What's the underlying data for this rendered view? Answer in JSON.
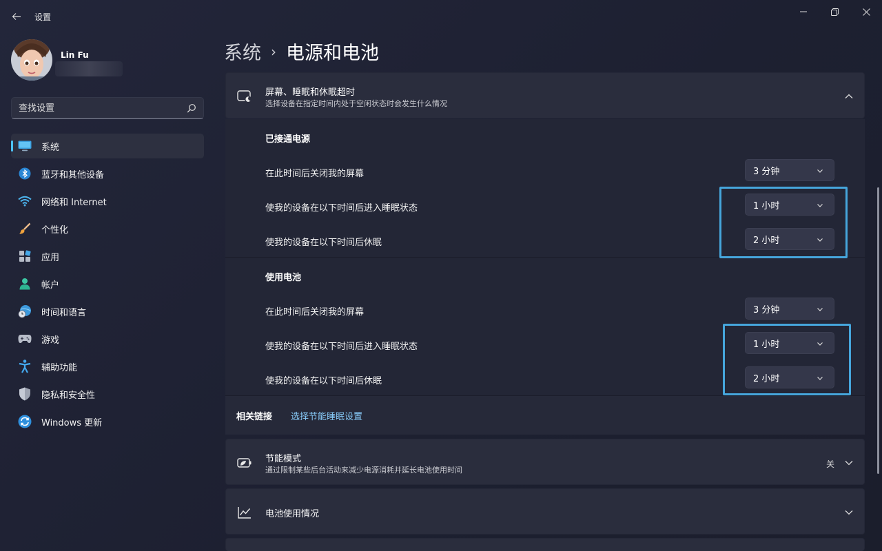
{
  "window": {
    "app_title": "设置",
    "controls": {
      "minimize": "minimize",
      "maximize": "maximize",
      "close": "close"
    }
  },
  "user": {
    "name": "Lin Fu"
  },
  "search": {
    "placeholder": "查找设置"
  },
  "sidebar": {
    "items": [
      {
        "label": "系统",
        "icon": "monitor-icon",
        "active": true
      },
      {
        "label": "蓝牙和其他设备",
        "icon": "bluetooth-icon"
      },
      {
        "label": "网络和 Internet",
        "icon": "wifi-icon"
      },
      {
        "label": "个性化",
        "icon": "brush-icon"
      },
      {
        "label": "应用",
        "icon": "apps-icon"
      },
      {
        "label": "帐户",
        "icon": "person-icon"
      },
      {
        "label": "时间和语言",
        "icon": "globe-clock-icon"
      },
      {
        "label": "游戏",
        "icon": "gamepad-icon"
      },
      {
        "label": "辅助功能",
        "icon": "accessibility-icon"
      },
      {
        "label": "隐私和安全性",
        "icon": "shield-icon"
      },
      {
        "label": "Windows 更新",
        "icon": "update-icon"
      }
    ]
  },
  "breadcrumb": {
    "parent": "系统",
    "separator": "›",
    "current": "电源和电池"
  },
  "screen_sleep": {
    "title": "屏幕、睡眠和休眠超时",
    "subtitle": "选择设备在指定时间内处于空闲状态时会发生什么情况",
    "plugged_in": {
      "heading": "已接通电源",
      "rows": [
        {
          "label": "在此时间后关闭我的屏幕",
          "value": "3 分钟"
        },
        {
          "label": "使我的设备在以下时间后进入睡眠状态",
          "value": "1 小时"
        },
        {
          "label": "使我的设备在以下时间后休眠",
          "value": "2 小时"
        }
      ]
    },
    "battery": {
      "heading": "使用电池",
      "rows": [
        {
          "label": "在此时间后关闭我的屏幕",
          "value": "3 分钟"
        },
        {
          "label": "使我的设备在以下时间后进入睡眠状态",
          "value": "1 小时"
        },
        {
          "label": "使我的设备在以下时间后休眠",
          "value": "2 小时"
        }
      ]
    }
  },
  "related": {
    "label": "相关链接",
    "link": "选择节能睡眠设置"
  },
  "energy_saver": {
    "title": "节能模式",
    "subtitle": "通过限制某些后台活动来减少电源消耗并延长电池使用时间",
    "status": "关"
  },
  "battery_usage": {
    "title": "电池使用情况"
  },
  "colors": {
    "accent": "#4cc2ff",
    "highlight": "#46a6dc",
    "link": "#86c8f5"
  }
}
